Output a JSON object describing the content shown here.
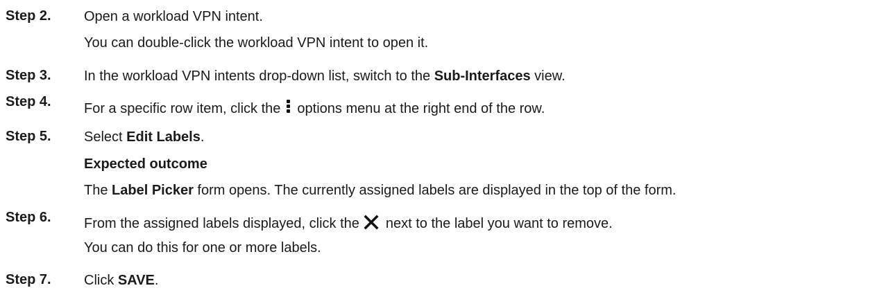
{
  "steps": [
    {
      "label": "Step 2.",
      "lines": [
        {
          "text": "Open a workload VPN intent."
        },
        {
          "text": "You can double-click the workload VPN intent to open it."
        }
      ]
    },
    {
      "label": "Step 3.",
      "pre": "In the workload VPN intents drop-down list, switch to the ",
      "bold": "Sub-Interfaces",
      "post": " view."
    },
    {
      "label": "Step 4.",
      "pre": "For a specific row item, click the",
      "icon": "more-options-vertical-icon",
      "post": "options menu at the right end of the row."
    },
    {
      "label": "Step 5.",
      "pre": "Select ",
      "bold": "Edit Labels",
      "post": ".",
      "outcome_heading": "Expected outcome",
      "outcome_pre": "The ",
      "outcome_bold": "Label Picker",
      "outcome_post": " form opens. The currently assigned labels are displayed in the top of the form."
    },
    {
      "label": "Step 6.",
      "pre": "From the assigned labels displayed, click the",
      "icon": "close-x-icon",
      "post": "next to the label you want to remove.",
      "line2": "You can do this for one or more labels."
    },
    {
      "label": "Step 7.",
      "pre": "Click ",
      "bold": "SAVE",
      "post": "."
    }
  ]
}
